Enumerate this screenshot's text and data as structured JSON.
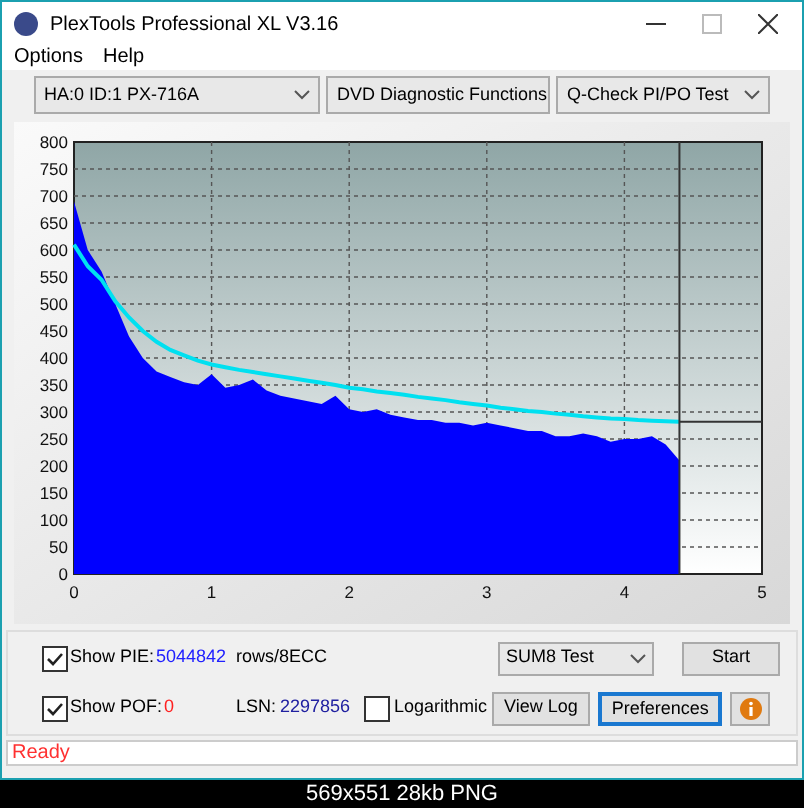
{
  "window": {
    "title": "PlexTools Professional XL V3.16"
  },
  "menu": [
    "Options",
    "Help"
  ],
  "selectors": [
    "HA:0 ID:1  PX-716A",
    "DVD Diagnostic Functions",
    "Q-Check PI/PO Test"
  ],
  "chart": {
    "chart_data": {
      "type": "area",
      "grid": true,
      "ref_lines": [
        {
          "axis": "x",
          "value": 4.4,
          "color": "#333333"
        },
        {
          "axis": "y",
          "value": 282,
          "color": "#333333"
        }
      ],
      "xlim": [
        0,
        5
      ],
      "ylim": [
        0,
        800
      ],
      "xticks": [
        0,
        1,
        2,
        3,
        4,
        5
      ],
      "yticks": [
        0,
        50,
        100,
        150,
        200,
        250,
        300,
        350,
        400,
        450,
        500,
        550,
        600,
        650,
        700,
        750,
        800
      ],
      "x": [
        0,
        0.1,
        0.2,
        0.3,
        0.4,
        0.5,
        0.6,
        0.7,
        0.8,
        0.9,
        1,
        1.1,
        1.2,
        1.3,
        1.4,
        1.5,
        1.6,
        1.7,
        1.8,
        1.9,
        2,
        2.1,
        2.2,
        2.3,
        2.4,
        2.5,
        2.6,
        2.7,
        2.8,
        2.9,
        3,
        3.1,
        3.2,
        3.3,
        3.4,
        3.5,
        3.6,
        3.7,
        3.8,
        3.9,
        4,
        4.1,
        4.2,
        4.3,
        4.4
      ],
      "series": [
        {
          "type": "area",
          "color": "#0000ff",
          "values": [
            690,
            600,
            560,
            500,
            440,
            400,
            375,
            365,
            355,
            350,
            370,
            345,
            350,
            360,
            340,
            330,
            325,
            320,
            315,
            330,
            305,
            300,
            305,
            295,
            290,
            285,
            285,
            280,
            280,
            275,
            280,
            275,
            270,
            265,
            265,
            255,
            255,
            260,
            255,
            245,
            250,
            250,
            255,
            240,
            210
          ]
        },
        {
          "type": "line",
          "color": "#00e0f0",
          "values": [
            610,
            570,
            545,
            505,
            475,
            450,
            430,
            415,
            405,
            395,
            388,
            383,
            378,
            374,
            370,
            366,
            362,
            358,
            354,
            350,
            345,
            342,
            338,
            335,
            332,
            328,
            325,
            322,
            318,
            315,
            312,
            308,
            305,
            302,
            300,
            297,
            295,
            292,
            290,
            288,
            287,
            285,
            284,
            283,
            282
          ]
        }
      ]
    }
  },
  "controls": {
    "show_pie": {
      "label": "Show PIE:",
      "checked": true,
      "value": "5044842",
      "unit": "rows/8ECC"
    },
    "show_pof": {
      "label": "Show POF:",
      "checked": true,
      "value": "0"
    },
    "lsn": {
      "label": "LSN:",
      "value": "2297856"
    },
    "logarithmic": {
      "label": "Logarithmic",
      "checked": false
    },
    "test_select": "SUM8 Test",
    "buttons": [
      {
        "label": "Start",
        "selected": false
      },
      {
        "label": "View Log",
        "selected": false
      },
      {
        "label": "Preferences",
        "selected": true
      }
    ]
  },
  "status_bar": "Ready",
  "caption": "569x551 28kb PNG"
}
